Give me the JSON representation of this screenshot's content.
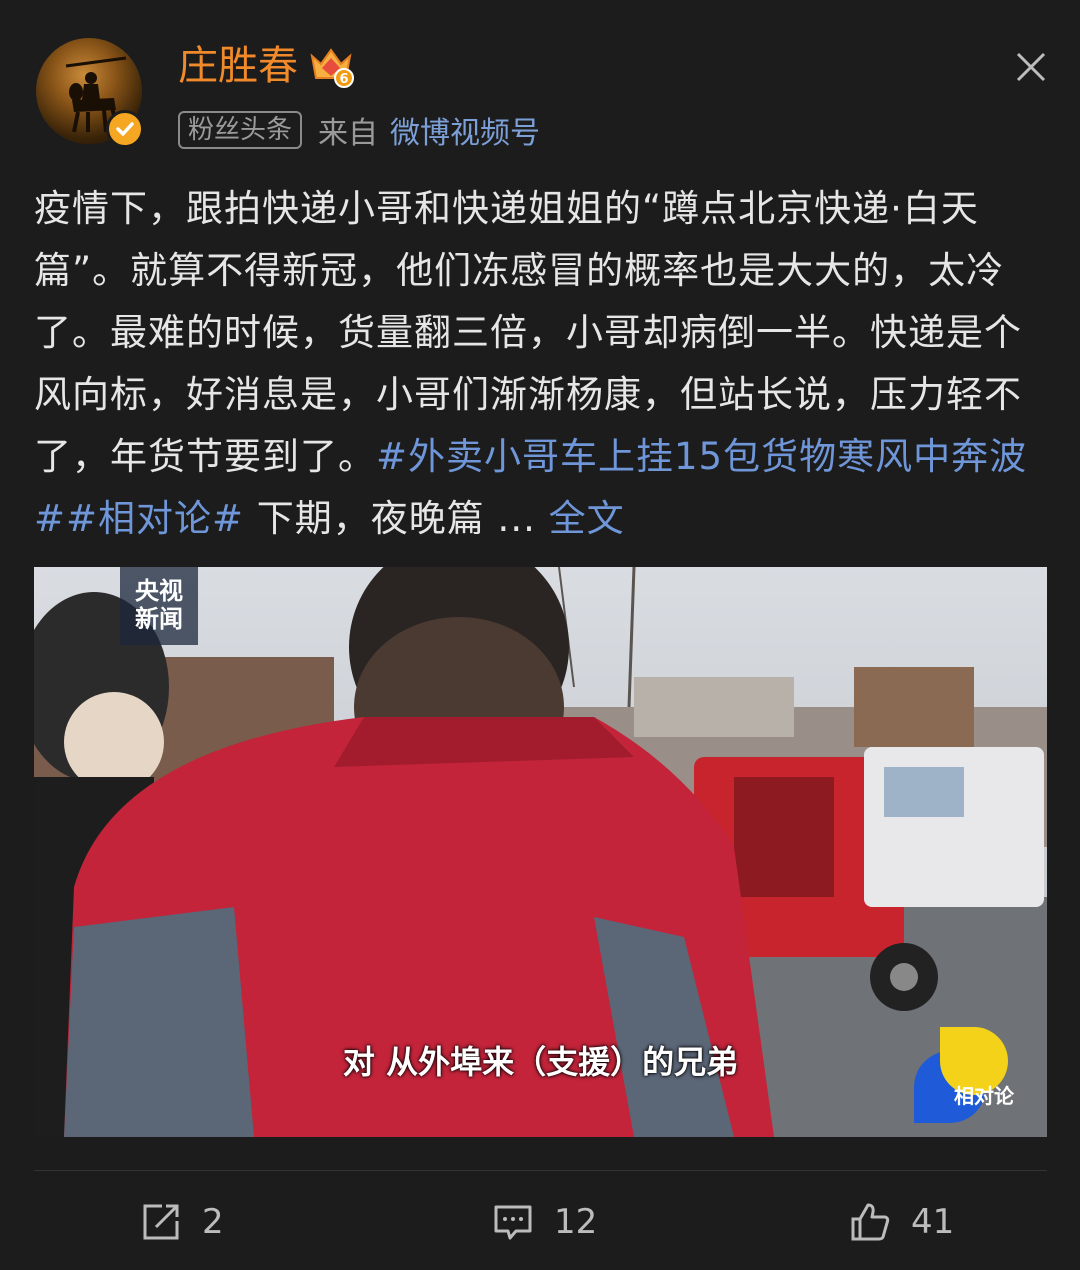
{
  "header": {
    "username": "庄胜春",
    "crown_level": "6",
    "tag": "粉丝头条",
    "from_label": "来自",
    "source": "微博视频号"
  },
  "post": {
    "text_main": "疫情下，跟拍快递小哥和快递姐姐的“蹲点北京快递·白天篇”。就算不得新冠，他们冻感冒的概率也是大大的，太冷了。最难的时候，货量翻三倍，小哥却病倒一半。快递是个风向标，好消息是，小哥们渐渐杨康，但站长说，压力轻不了，年货节要到了。",
    "topic1": "#外卖小哥车上挂15包货物寒风中奔波#",
    "topic2": "#相对论#",
    "text_tail": " 下期，夜晚篇 ...",
    "full_text_link": "全文"
  },
  "media": {
    "logo_line1": "央视",
    "logo_line2": "新闻",
    "subtitle": "对 从外埠来（支援）的兄弟",
    "brand": "相对论"
  },
  "actions": {
    "repost_count": "2",
    "comment_count": "12",
    "like_count": "41"
  },
  "colors": {
    "username": "#f08a2a",
    "link": "#6f96d8",
    "background": "#1c1c1c"
  }
}
